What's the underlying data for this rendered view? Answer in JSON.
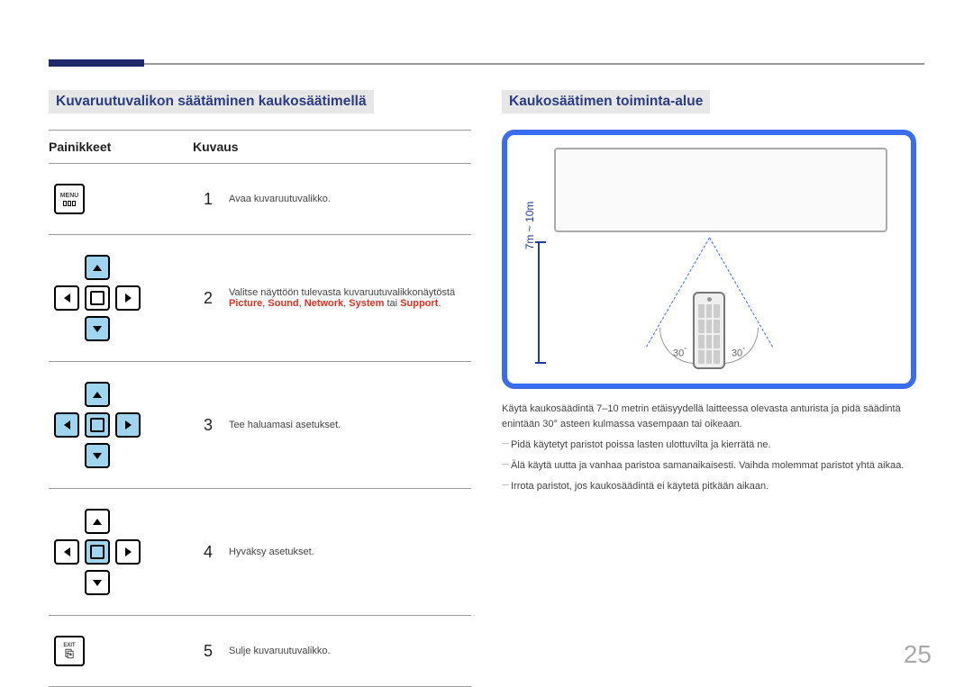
{
  "left": {
    "heading": "Kuvaruutuvalikon säätäminen kaukosäätimellä",
    "headers": {
      "col1": "Painikkeet",
      "col2": "Kuvaus"
    },
    "rows": [
      {
        "num": "1",
        "icon_name": "menu-button-icon",
        "icon_label": "MENU",
        "desc": "Avaa kuvaruutuvalikko."
      },
      {
        "num": "2",
        "icon_name": "dpad-up-down-icon",
        "desc": "Valitse näyttöön tulevasta kuvaruutuvalikkonäytöstä",
        "keys": {
          "k1": "Picture",
          "k2": "Sound",
          "k3": "Network",
          "k4": "System",
          "sep": " tai ",
          "k5": "Support"
        }
      },
      {
        "num": "3",
        "icon_name": "dpad-all-icon",
        "desc": "Tee haluamasi asetukset."
      },
      {
        "num": "4",
        "icon_name": "dpad-enter-icon",
        "desc": "Hyväksy asetukset."
      },
      {
        "num": "5",
        "icon_name": "exit-button-icon",
        "icon_label": "EXIT",
        "desc": "Sulje kuvaruutuvalikko."
      }
    ]
  },
  "right": {
    "heading": "Kaukosäätimen toiminta-alue",
    "distance_label": "7m ~ 10m",
    "angle_left": "30",
    "angle_right": "30",
    "para_main": "Käytä kaukosäädintä 7–10 metrin etäisyydellä laitteessa olevasta anturista ja pidä säädintä enintään 30° asteen kulmassa vasempaan tai oikeaan.",
    "bullets": [
      "Pidä käytetyt paristot poissa lasten ulottuvilta ja kierrätä ne.",
      "Älä käytä uutta ja vanhaa paristoa samanaikaisesti. Vaihda molemmat paristot yhtä aikaa.",
      "Irrota paristot, jos kaukosäädintä ei käytetä pitkään aikaan."
    ]
  },
  "page_number": "25"
}
